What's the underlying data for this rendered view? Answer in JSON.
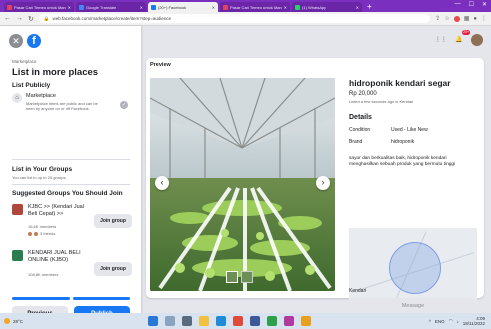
{
  "browser": {
    "tabs": [
      {
        "label": "Pasar Cari Temeo untuk Man",
        "color": "#e4405f",
        "active": false
      },
      {
        "label": "Google Translate",
        "color": "#4285f4",
        "active": false
      },
      {
        "label": "(20+) Facebook",
        "color": "#1877f2",
        "active": true
      },
      {
        "label": "Pasar Cari Temeo untuk Man",
        "color": "#e4405f",
        "active": false
      },
      {
        "label": "(1) WhatsApp",
        "color": "#25d366",
        "active": false
      }
    ],
    "url": "web.facebook.com/marketplace/create/item?step=audience"
  },
  "sidebar": {
    "breadcrumb": "Marketplace",
    "title": "List in more places",
    "list_publicly": {
      "heading": "List Publicly",
      "item_title": "Marketplace",
      "item_desc": "Marketplace items are public and can be seen by anyone on or off Facebook."
    },
    "list_groups": {
      "heading": "List in Your Groups",
      "sub": "You can list in up to 20 groups."
    },
    "suggested": {
      "heading": "Suggested Groups You Should Join",
      "groups": [
        {
          "name": "KJBC >> (Kendari Jual Beli Cepat) >>",
          "members": "16,6K members",
          "friends": "3 friends",
          "join": "Join group"
        },
        {
          "name": "KENDARI JUAL BELI ONLINE (KJBO)",
          "members": "108,8K members",
          "join": "Join group"
        }
      ]
    },
    "previous": "Previous",
    "publish": "Publish"
  },
  "header": {
    "notif_badge": "20+"
  },
  "preview": {
    "label": "Preview",
    "title": "hidroponik kendari segar",
    "price": "Rp 20,000",
    "listed": "Listed a few seconds ago in Kendari",
    "details_heading": "Details",
    "details": [
      {
        "key": "Condition",
        "value": "Used - Like New"
      },
      {
        "key": "Brand",
        "value": "hidroponik"
      }
    ],
    "description": "sayur dan berkualitas baik, hidroponik kendari menghasilkan sebuah produk yang bermutu tinggi",
    "location": "Kendari",
    "message_btn": "Message"
  },
  "taskbar": {
    "weather": "28°C",
    "lang": "ENG",
    "time": "4:09",
    "date": "18/11/2022"
  },
  "colors": {
    "accent": "#1877f2",
    "tabbar": "#7b2fbe"
  }
}
